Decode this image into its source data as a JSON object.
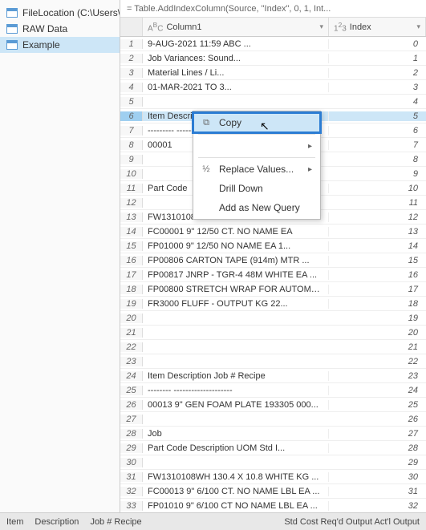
{
  "queries": [
    {
      "label": "FileLocation (C:\\Users\\lisde..."
    },
    {
      "label": "RAW Data"
    },
    {
      "label": "Example"
    }
  ],
  "selected_query_index": 2,
  "formula_bar": "= Table.AddIndexColumn(Source, \"Index\", 0, 1, Int...",
  "columns": [
    {
      "type": "ABC",
      "label": "Column1"
    },
    {
      "type": "123",
      "label": "Index"
    }
  ],
  "rows": [
    {
      "n": 1,
      "c1": "9-AUG-2021 11:59                              ABC ...",
      "c2": "0"
    },
    {
      "n": 2,
      "c1": "                                   Job Variances: Sound...",
      "c2": "1"
    },
    {
      "n": 3,
      "c1": "                                   Material Lines / Li...",
      "c2": "2"
    },
    {
      "n": 4,
      "c1": "                                   01-MAR-2021 TO 3...",
      "c2": "3"
    },
    {
      "n": 5,
      "c1": "",
      "c2": "4"
    },
    {
      "n": 6,
      "c1": "Item      Description              Job #  Recipe",
      "c2": "5",
      "selected": true
    },
    {
      "n": 7,
      "c1": "---------      --------------------",
      "c2": "6"
    },
    {
      "n": 8,
      "c1": "00001",
      "c2": "7"
    },
    {
      "n": 9,
      "c1": "",
      "c2": "8"
    },
    {
      "n": 10,
      "c1": "",
      "c2": "9"
    },
    {
      "n": 11,
      "c1": "     Part Code",
      "c2": "10"
    },
    {
      "n": 12,
      "c1": "",
      "c2": "11"
    },
    {
      "n": 13,
      "c1": "     FW1310108WH  130.4 X 10.8       WHITE KG   ...",
      "c2": "12"
    },
    {
      "n": 14,
      "c1": "     FC00001      9\" 12/50 CT. NO NAME     EA",
      "c2": "13"
    },
    {
      "n": 15,
      "c1": "     FP01000      9\" 12/50 NO NAME         EA    1...",
      "c2": "14"
    },
    {
      "n": 16,
      "c1": "     FP00806      CARTON TAPE (914m)       MTR  ...",
      "c2": "15"
    },
    {
      "n": 17,
      "c1": "     FP00817      JNRP - TGR-4 48M WHITE   EA   ...",
      "c2": "16"
    },
    {
      "n": 18,
      "c1": "     FP00800      STRETCH WRAP FOR AUTOMATI ...",
      "c2": "17"
    },
    {
      "n": 19,
      "c1": "     FR3000       FLUFF - OUTPUT           KG    22...",
      "c2": "18"
    },
    {
      "n": 20,
      "c1": "",
      "c2": "19"
    },
    {
      "n": 21,
      "c1": "",
      "c2": "20"
    },
    {
      "n": 22,
      "c1": "",
      "c2": "21"
    },
    {
      "n": 23,
      "c1": "",
      "c2": "22"
    },
    {
      "n": 24,
      "c1": "Item       Description              Job #  Recipe",
      "c2": "23"
    },
    {
      "n": 25,
      "c1": "--------      --------------------",
      "c2": "24"
    },
    {
      "n": 26,
      "c1": "00013    9\" GEN FOAM PLATE        193305 000...",
      "c2": "25"
    },
    {
      "n": 27,
      "c1": "",
      "c2": "26"
    },
    {
      "n": 28,
      "c1": "                                Job",
      "c2": "27"
    },
    {
      "n": 29,
      "c1": "     Part Code   Description              UOM   Std I...",
      "c2": "28"
    },
    {
      "n": 30,
      "c1": "",
      "c2": "29"
    },
    {
      "n": 31,
      "c1": "     FW1310108WH  130.4 X 10.8       WHITE KG   ...",
      "c2": "30"
    },
    {
      "n": 32,
      "c1": "     FC00013      9\" 6/100 CT. NO NAME LBL  EA  ...",
      "c2": "31"
    },
    {
      "n": 33,
      "c1": "     FP01010      9\" 6/100 CT NO NAME LBL   EA  ...",
      "c2": "32"
    }
  ],
  "context_menu": {
    "items": [
      {
        "icon": "copy",
        "label": "Copy",
        "highlight": true
      },
      {
        "sep": true
      },
      {
        "icon": "",
        "label": "",
        "submenu": true
      },
      {
        "sep": true
      },
      {
        "icon": "replace",
        "label": "Replace Values...",
        "submenu": true
      },
      {
        "icon": "",
        "label": "Drill Down"
      },
      {
        "icon": "",
        "label": "Add as New Query"
      }
    ]
  },
  "status": {
    "left": [
      "Item",
      "Description",
      "Job #  Recipe"
    ],
    "right": "Std Cost Req'd Output Act'l Output"
  }
}
